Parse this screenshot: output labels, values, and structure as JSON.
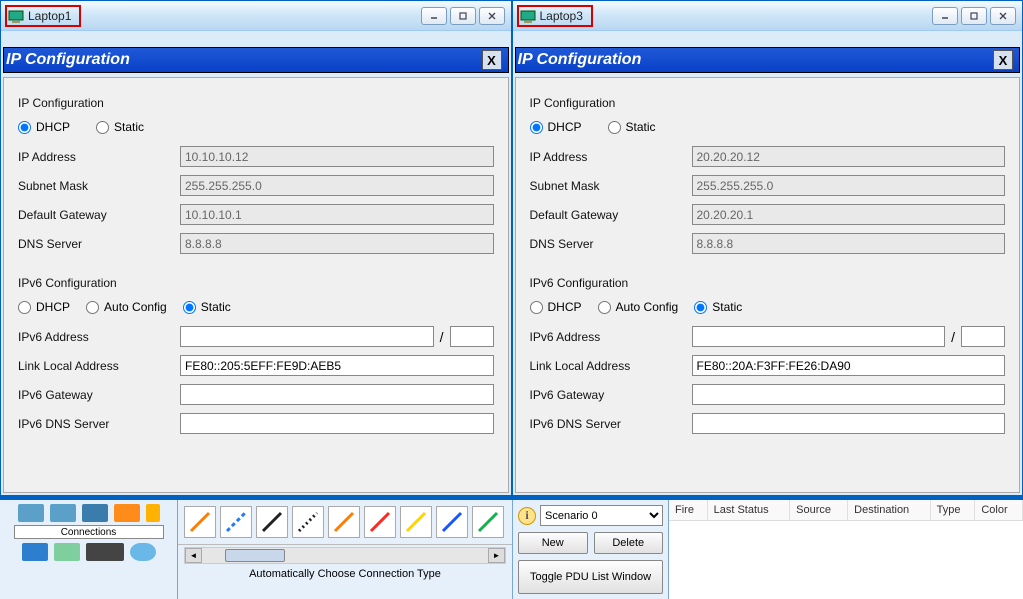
{
  "windows": [
    {
      "title": "Laptop1",
      "panel_title": "IP Configuration",
      "ipv4": {
        "heading": "IP Configuration",
        "mode_dhcp": "DHCP",
        "mode_static": "Static",
        "selected_mode": "DHCP",
        "ip_label": "IP Address",
        "ip_value": "10.10.10.12",
        "subnet_label": "Subnet Mask",
        "subnet_value": "255.255.255.0",
        "gateway_label": "Default Gateway",
        "gateway_value": "10.10.10.1",
        "dns_label": "DNS Server",
        "dns_value": "8.8.8.8"
      },
      "ipv6": {
        "heading": "IPv6 Configuration",
        "mode_dhcp": "DHCP",
        "mode_auto": "Auto Config",
        "mode_static": "Static",
        "selected_mode": "Static",
        "addr_label": "IPv6 Address",
        "addr_value": "",
        "prefix_value": "",
        "ll_label": "Link Local Address",
        "ll_value": "FE80::205:5EFF:FE9D:AEB5",
        "gw_label": "IPv6 Gateway",
        "gw_value": "",
        "dns_label": "IPv6 DNS Server",
        "dns_value": ""
      }
    },
    {
      "title": "Laptop3",
      "panel_title": "IP Configuration",
      "ipv4": {
        "heading": "IP Configuration",
        "mode_dhcp": "DHCP",
        "mode_static": "Static",
        "selected_mode": "DHCP",
        "ip_label": "IP Address",
        "ip_value": "20.20.20.12",
        "subnet_label": "Subnet Mask",
        "subnet_value": "255.255.255.0",
        "gateway_label": "Default Gateway",
        "gateway_value": "20.20.20.1",
        "dns_label": "DNS Server",
        "dns_value": "8.8.8.8"
      },
      "ipv6": {
        "heading": "IPv6 Configuration",
        "mode_dhcp": "DHCP",
        "mode_auto": "Auto Config",
        "mode_static": "Static",
        "selected_mode": "Static",
        "addr_label": "IPv6 Address",
        "addr_value": "",
        "prefix_value": "",
        "ll_label": "Link Local Address",
        "ll_value": "FE80::20A:F3FF:FE26:DA90",
        "gw_label": "IPv6 Gateway",
        "gw_value": "",
        "dns_label": "IPv6 DNS Server",
        "dns_value": ""
      }
    }
  ],
  "bottom": {
    "connections_label": "Connections",
    "auto_label": "Automatically Choose Connection Type",
    "scenario_selected": "Scenario 0",
    "new_btn": "New",
    "delete_btn": "Delete",
    "toggle_btn": "Toggle PDU List Window",
    "table_headers": [
      "Fire",
      "Last Status",
      "Source",
      "Destination",
      "Type",
      "Color"
    ]
  },
  "tool_colors": [
    "#ff7e00",
    "#1f7cff",
    "#222222",
    "#222222",
    "#ff7e00",
    "#ff2a1f",
    "#ffd400",
    "#1756ff",
    "#10b24a"
  ]
}
